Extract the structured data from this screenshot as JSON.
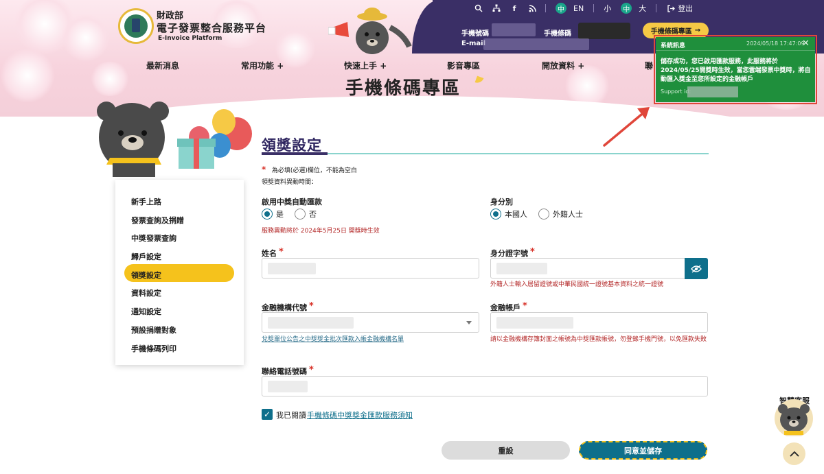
{
  "brand": {
    "ministry": "財政部",
    "title": "電子發票整合服務平台",
    "subtitle_en": "E-Invoice Platform"
  },
  "utility": {
    "lang_zh": "中",
    "lang_en": "EN",
    "size_small": "小",
    "size_mid": "中",
    "size_large": "大",
    "logout": "登出"
  },
  "account": {
    "phone_label": "手機號碼",
    "barcode_label": "手機條碼",
    "email_label": "E-mail",
    "barcode_button": "手機條碼專區"
  },
  "nav": {
    "items": [
      "最新消息",
      "常用功能",
      "快速上手",
      "影音專區",
      "開放資料",
      "聯"
    ]
  },
  "page_heading": "手機條碼專區",
  "toast": {
    "title": "系統訊息",
    "time": "2024/05/18 17:47:09",
    "message": "儲存成功，您已啟用匯款服務，此服務將於2024/05/25開獎時生效，當您雲端發票中獎時，將自動匯入獎金至您所設定的金融帳戶",
    "support_label": "Support id:"
  },
  "sidebar": {
    "items": [
      "新手上路",
      "發票查詢及捐贈",
      "中獎發票查詢",
      "歸戶設定",
      "領獎設定",
      "資料設定",
      "通知設定",
      "預設捐贈對象",
      "手機條碼列印"
    ],
    "active_index": 4
  },
  "form": {
    "section_title": "領獎設定",
    "required_note": "為必填(必選)欄位，不能為空白",
    "change_time_label": "領獎資料異動時間：",
    "auto_transfer": {
      "label": "啟用中獎自動匯款",
      "options": [
        "是",
        "否"
      ],
      "selected": "是",
      "hint": "服務異動將於 2024年5月25日 開獎時生效"
    },
    "identity": {
      "label": "身分別",
      "options": [
        "本國人",
        "外籍人士"
      ],
      "selected": "本國人"
    },
    "name": {
      "label": "姓名"
    },
    "id_number": {
      "label": "身分證字號",
      "hint": "外籍人士輸入居留證號或中華民國統一證號基本資料之統一證號"
    },
    "bank_code": {
      "label": "金融機構代號",
      "hint_link": "兌獎單位公告之中獎獎金批次匯款入帳金融機構名單"
    },
    "bank_account": {
      "label": "金融帳戶",
      "hint": "請以金融機構存簿封面之帳號為中獎匯款帳號，勿登錄手機門號，以免匯款失敗"
    },
    "phone": {
      "label": "聯絡電話號碼"
    },
    "agree": {
      "prefix": "我已閱讀",
      "link": "手機條碼中獎獎金匯款服務須知",
      "checked": true
    },
    "reset_button": "重設",
    "save_button": "同意並儲存"
  },
  "floating": {
    "customer_service": "智慧客服"
  },
  "colors": {
    "brand_purple": "#3a2f66",
    "accent_teal": "#0e6f8b",
    "accent_yellow": "#f5c21c",
    "toast_green": "#1f8f3c",
    "error_red": "#b42a2a"
  }
}
